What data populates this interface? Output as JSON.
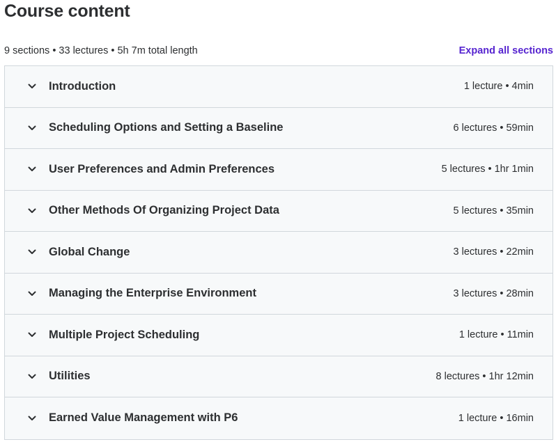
{
  "header": {
    "title": "Course content",
    "summary": "9 sections • 33 lectures • 5h 7m total length",
    "expand_label": "Expand all sections"
  },
  "colors": {
    "accent": "#5624d0",
    "section_bg": "#f7f9fa",
    "border": "#d1d7dc",
    "text": "#2d2f31"
  },
  "sections": [
    {
      "title": "Introduction",
      "meta": "1 lecture • 4min",
      "icon": "chevron-down-icon"
    },
    {
      "title": "Scheduling Options and Setting a Baseline",
      "meta": "6 lectures • 59min",
      "icon": "chevron-down-icon"
    },
    {
      "title": "User Preferences and Admin Preferences",
      "meta": "5 lectures • 1hr 1min",
      "icon": "chevron-down-icon"
    },
    {
      "title": "Other Methods Of Organizing Project Data",
      "meta": "5 lectures • 35min",
      "icon": "chevron-down-icon"
    },
    {
      "title": "Global Change",
      "meta": "3 lectures • 22min",
      "icon": "chevron-down-icon"
    },
    {
      "title": "Managing the Enterprise Environment",
      "meta": "3 lectures • 28min",
      "icon": "chevron-down-icon"
    },
    {
      "title": "Multiple Project Scheduling",
      "meta": "1 lecture • 11min",
      "icon": "chevron-down-icon"
    },
    {
      "title": "Utilities",
      "meta": "8 lectures • 1hr 12min",
      "icon": "chevron-down-icon"
    },
    {
      "title": "Earned Value Management with P6",
      "meta": "1 lecture • 16min",
      "icon": "chevron-down-icon"
    }
  ]
}
